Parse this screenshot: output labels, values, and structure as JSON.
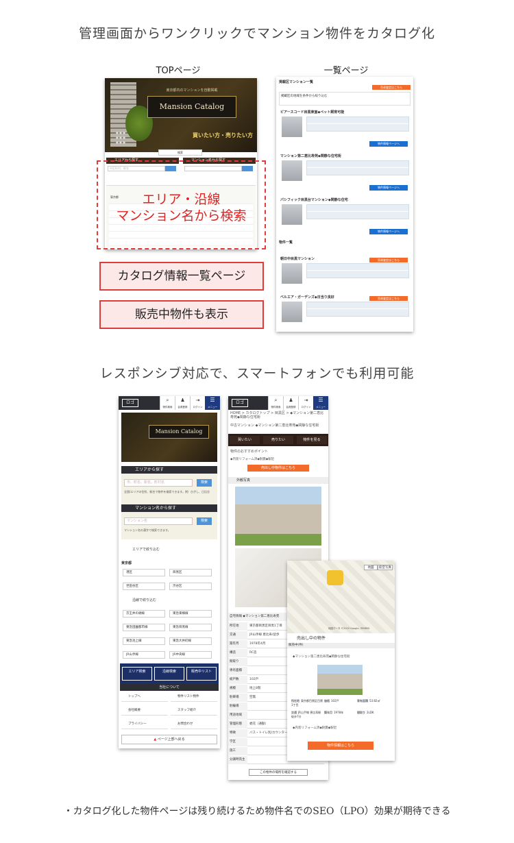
{
  "headings": {
    "main": "管理画面からワンクリックでマンション物件をカタログ化",
    "responsive": "レスポンシブ対応で、スマートフォンでも利用可能",
    "footer_note": "・カタログ化した物件ページは残り続けるため物件名でのSEO（LPO）効果が期待できる"
  },
  "labels": {
    "top_page": "TOPページ",
    "list_page": "一覧ページ"
  },
  "callouts": {
    "search_line1": "エリア・沿線",
    "search_line2": "マンション名から検索",
    "catalog_list": "カタログ情報一覧ページ",
    "for_sale": "販売中物件も表示"
  },
  "top_mock": {
    "banner_title": "Mansion Catalog",
    "banner_sub": "東京都内のマンションを自動掲載",
    "hero_catch": "買いたい方・売りたい方",
    "area_search": "エリアから探す",
    "name_search": "マンション名から探す",
    "search_button": "検索",
    "area_placeholder": "市区町村、駅名",
    "tokyo": "東京都"
  },
  "list_mock": {
    "header": "掲載区マンション一覧",
    "search_head": "掲載区の地域を条件から絞り込む",
    "item1": "ビアースコード目黒東面◆ペット飼育可能",
    "item2": "マンション第二恵比寿苑◆閑静な住宅街",
    "item3": "パシフィック目黒台マンション◆閑静な住宅",
    "section": "物件一覧",
    "item4": "朝日中目黒マンション",
    "item5": "ベルエア・ガーデンズ◆日当り良好",
    "detail_button": "物件情報ページへ",
    "orange_button": "売却査定はこちら"
  },
  "phone1": {
    "logo": "ロゴ",
    "icons": [
      "物件検索",
      "会員登録",
      "ログイン",
      "メニュー"
    ],
    "area_title": "エリアから探す",
    "area_placeholder": "市、町名、駅名、町村名",
    "search_button": "検索",
    "area_help": "全国/エリアの住所、駅名で物件を検索できます。例）ひがし、日比谷",
    "name_title": "マンション名から探す",
    "name_placeholder": "マンション名",
    "name_help": "マンション名の漢字で検索できます。",
    "refine_area": "エリアで絞り込む",
    "tokyo": "東京都",
    "wards": [
      "港区",
      "目黒区",
      "世田谷区",
      "渋谷区"
    ],
    "refine_line": "沿線で絞り込む",
    "lines": [
      "京王井の頭線",
      "東急東横線",
      "東急田園都市線",
      "東急目黒線",
      "東急池上線",
      "東急大井町線",
      "JR山手線",
      "JR中央線"
    ],
    "nav_buttons": [
      "エリア検索",
      "沿線検索",
      "販売中リスト"
    ],
    "site_title": "当社について",
    "site_links": [
      "トップへ",
      "物件リスト物件",
      "会社概要",
      "スタッフ紹介",
      "プライバシー",
      "お問合わせ"
    ],
    "back_to_top": "ページ上部へ戻る"
  },
  "phone2": {
    "logo": "ロゴ",
    "breadcrumb": "HOME > カタログトップ > 目黒区 > ◆マンション第二恵比寿苑◆閑静な住宅街",
    "subtitle": "中古マンション ◆マンション第二恵比寿苑◆閑静な住宅街",
    "tabs": [
      "買いたい",
      "売りたい",
      "物件を見る"
    ],
    "point_title": "物件のおすすめポイント",
    "point_text": "◆内装リフォーム済◆耐震◆駅近",
    "sale_button": "売出し中物件はこちら",
    "photos_title": "外観写真",
    "table_head": "自宅情報 ◆マンション第二恵比寿苑",
    "rows": [
      {
        "k": "所在地",
        "v": "東京都目黒区目黒1丁目"
      },
      {
        "k": "交通",
        "v": "JR山手線 恵比寿/徒歩"
      },
      {
        "k": "築年月",
        "v": "1978年4月"
      },
      {
        "k": "構造",
        "v": "RC造"
      },
      {
        "k": "間取り",
        "v": ""
      },
      {
        "k": "専有面積",
        "v": ""
      },
      {
        "k": "総戸数",
        "v": "102戸"
      },
      {
        "k": "規模",
        "v": "地上8階"
      },
      {
        "k": "駐車場",
        "v": "空無"
      },
      {
        "k": "駐輪場",
        "v": ""
      },
      {
        "k": "用途地域",
        "v": ""
      },
      {
        "k": "管理形態",
        "v": "委託（通勤）"
      },
      {
        "k": "特徴",
        "v": "バス・トイレ別/カウンターキッチン"
      },
      {
        "k": "学区",
        "v": ""
      },
      {
        "k": "施工",
        "v": ""
      },
      {
        "k": "分譲時売主",
        "v": ""
      }
    ],
    "confirm_button": "この物件の場所を確認する"
  },
  "phone3": {
    "map_tabs": [
      "地図",
      "航空写真"
    ],
    "map_credit": "地図データ ©2019 Google, ZENRIN",
    "section_title": "売出し中の物件",
    "sub_head": "販売中(件)",
    "property": "◆マンション第二恵比寿苑◆閑静な住宅街",
    "specs": [
      {
        "k": "所在地",
        "v": "東京都目黒区目黒1丁目"
      },
      {
        "k": "価格",
        "v": "102戸"
      },
      {
        "k": "専有面積",
        "v": "53.82㎡"
      },
      {
        "k": "交通",
        "v": "JR山手線 恵比寿駅 徒歩7分"
      },
      {
        "k": "築年月",
        "v": "1978年"
      },
      {
        "k": "間取り",
        "v": "2LDK"
      }
    ],
    "point_text": "◆内装リフォーム済◆耐震◆駅近",
    "detail_button": "物件情報はこちら"
  }
}
